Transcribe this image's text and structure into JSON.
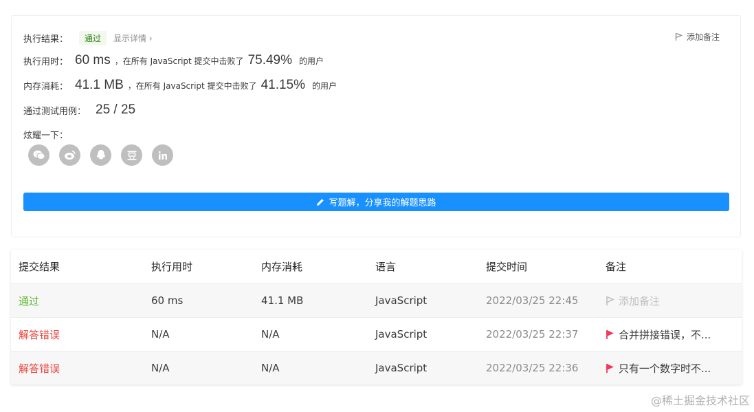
{
  "result": {
    "exec_result_label": "执行结果：",
    "status": "通过",
    "show_details": "显示详情 ›",
    "add_note": "添加备注",
    "runtime_label": "执行用时：",
    "runtime_value": "60 ms",
    "runtime_mid": "，在所有 JavaScript 提交中击败了",
    "runtime_pct": "75.49%",
    "runtime_suffix": "的用户",
    "memory_label": "内存消耗：",
    "memory_value": "41.1 MB",
    "memory_mid": "，在所有 JavaScript 提交中击败了",
    "memory_pct": "41.15%",
    "memory_suffix": "的用户",
    "tests_label": "通过测试用例：",
    "tests_value": "25 / 25",
    "share_label": "炫耀一下：",
    "share_icons": [
      "wechat-icon",
      "weibo-icon",
      "qq-icon",
      "douban-icon",
      "linkedin-icon"
    ],
    "write_solution": "写题解，分享我的解题思路",
    "accent_color": "#1890ff"
  },
  "submissions": {
    "headers": [
      "提交结果",
      "执行用时",
      "内存消耗",
      "语言",
      "提交时间",
      "备注"
    ],
    "rows": [
      {
        "result": "通过",
        "runtime": "60 ms",
        "memory": "41.1 MB",
        "lang": "JavaScript",
        "time": "2022/03/25 22:45",
        "note": "添加备注"
      },
      {
        "result": "解答错误",
        "runtime": "N/A",
        "memory": "N/A",
        "lang": "JavaScript",
        "time": "2022/03/25 22:37",
        "note": "合并拼接错误，不..."
      },
      {
        "result": "解答错误",
        "runtime": "N/A",
        "memory": "N/A",
        "lang": "JavaScript",
        "time": "2022/03/25 22:36",
        "note": "只有一个数字时不..."
      }
    ],
    "colors": {
      "accepted": "#5cb82d",
      "wrong": "#e8453c",
      "flag": "#f5365c"
    }
  },
  "watermark": "@稀土掘金技术社区"
}
